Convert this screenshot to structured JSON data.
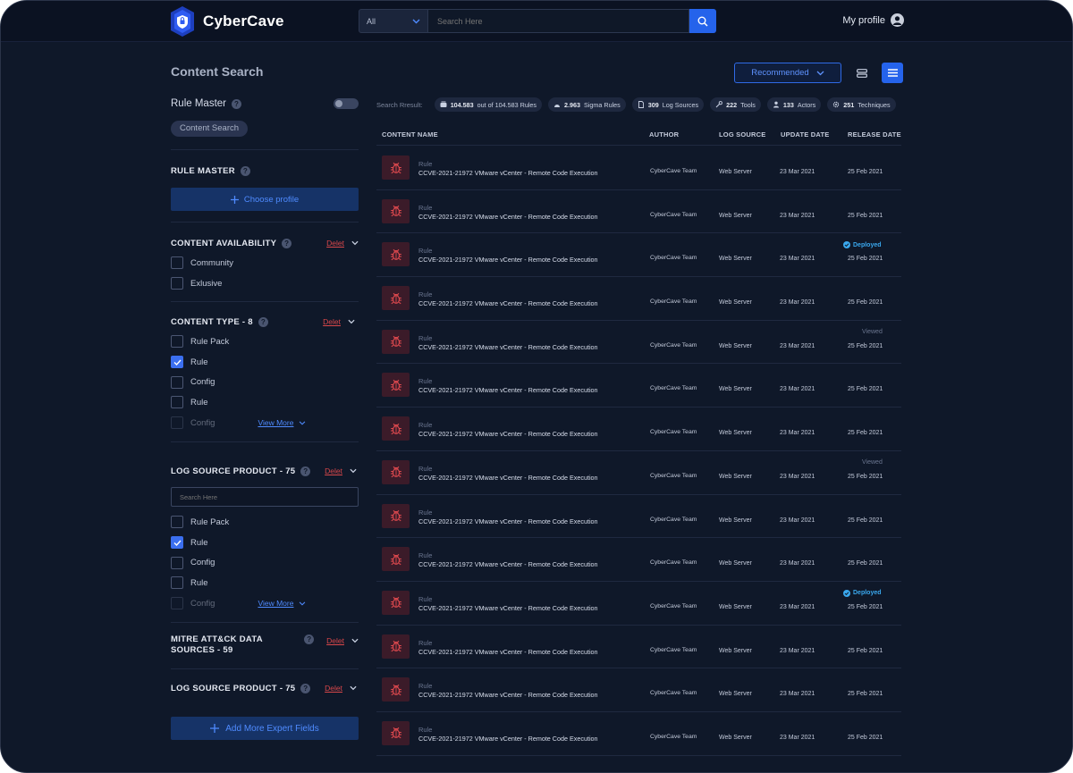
{
  "header": {
    "brand": "CyberCave",
    "search_category": "All",
    "search_placeholder": "Search Here",
    "profile_label": "My profile"
  },
  "page": {
    "title": "Content Search",
    "sort_label": "Recommended"
  },
  "sidebar": {
    "rule_master_label": "Rule Master",
    "content_search_pill": "Content Search",
    "rule_master_section": {
      "title": "RULE MASTER",
      "button": "Choose profile"
    },
    "content_availability": {
      "title": "CONTENT AVAILABILITY",
      "delete": "Delet",
      "options": [
        "Community",
        "Exlusive"
      ]
    },
    "content_type": {
      "title": "CONTENT TYPE - 8",
      "delete": "Delet",
      "options": [
        "Rule Pack",
        "Rule",
        "Config",
        "Rule",
        "Config"
      ],
      "view_more": "View More"
    },
    "log_source_product": {
      "title": "LOG SOURCE PRODUCT - 75",
      "delete": "Delet",
      "search_placeholder": "Search Here",
      "options": [
        "Rule Pack",
        "Rule",
        "Config",
        "Rule",
        "Config"
      ],
      "view_more": "View More"
    },
    "mitre": {
      "title_line1": "MITRE ATT&CK DATA",
      "title_line2": "SOURCES - 59",
      "delete": "Delet"
    },
    "log_source_product_2": {
      "title": "LOG SOURCE PRODUCT - 75",
      "delete": "Delet"
    },
    "add_more": "Add More Expert Fields"
  },
  "stats": {
    "label": "Search Rresult:",
    "rules_count": "104.583",
    "rules_text": "out of 104.583 Rules",
    "sigma_count": "2.963",
    "sigma_text": "Sigma Rules",
    "log_count": "309",
    "log_text": "Log Sources",
    "tools_count": "222",
    "tools_text": "Tools",
    "actors_count": "133",
    "actors_text": "Actors",
    "tech_count": "251",
    "tech_text": "Techniques"
  },
  "table": {
    "headers": {
      "name": "CONTENT NAME",
      "author": "AUTHOR",
      "log_source": "LOG SOURCE",
      "update": "UPDATE DATE",
      "release": "RELEASE DATE"
    },
    "rows": [
      {
        "type": "Rule",
        "title": "CCVE-2021-21972 VMware vCenter - Remote Code Execution",
        "author": "CyberCave Team",
        "log": "Web Server",
        "update": "23 Mar 2021",
        "release": "25 Feb 2021",
        "badge": ""
      },
      {
        "type": "Rule",
        "title": "CCVE-2021-21972 VMware vCenter - Remote Code Execution",
        "author": "CyberCave Team",
        "log": "Web Server",
        "update": "23 Mar 2021",
        "release": "25 Feb 2021",
        "badge": ""
      },
      {
        "type": "Rule",
        "title": "CCVE-2021-21972 VMware vCenter - Remote Code Execution",
        "author": "CyberCave Team",
        "log": "Web Server",
        "update": "23 Mar 2021",
        "release": "25 Feb 2021",
        "badge": "Deployed"
      },
      {
        "type": "Rule",
        "title": "CCVE-2021-21972 VMware vCenter - Remote Code Execution",
        "author": "CyberCave Team",
        "log": "Web Server",
        "update": "23 Mar 2021",
        "release": "25 Feb 2021",
        "badge": ""
      },
      {
        "type": "Rule",
        "title": "CCVE-2021-21972 VMware vCenter - Remote Code Execution",
        "author": "CyberCave Team",
        "log": "Web Server",
        "update": "23 Mar 2021",
        "release": "25 Feb 2021",
        "badge": "Viewed"
      },
      {
        "type": "Rule",
        "title": "CCVE-2021-21972 VMware vCenter - Remote Code Execution",
        "author": "CyberCave Team",
        "log": "Web Server",
        "update": "23 Mar 2021",
        "release": "25 Feb 2021",
        "badge": ""
      },
      {
        "type": "Rule",
        "title": "CCVE-2021-21972 VMware vCenter - Remote Code Execution",
        "author": "CyberCave Team",
        "log": "Web Server",
        "update": "23 Mar 2021",
        "release": "25 Feb 2021",
        "badge": ""
      },
      {
        "type": "Rule",
        "title": "CCVE-2021-21972 VMware vCenter - Remote Code Execution",
        "author": "CyberCave Team",
        "log": "Web Server",
        "update": "23 Mar 2021",
        "release": "25 Feb 2021",
        "badge": "Viewed"
      },
      {
        "type": "Rule",
        "title": "CCVE-2021-21972 VMware vCenter - Remote Code Execution",
        "author": "CyberCave Team",
        "log": "Web Server",
        "update": "23 Mar 2021",
        "release": "25 Feb 2021",
        "badge": ""
      },
      {
        "type": "Rule",
        "title": "CCVE-2021-21972 VMware vCenter - Remote Code Execution",
        "author": "CyberCave Team",
        "log": "Web Server",
        "update": "23 Mar 2021",
        "release": "25 Feb 2021",
        "badge": ""
      },
      {
        "type": "Rule",
        "title": "CCVE-2021-21972 VMware vCenter - Remote Code Execution",
        "author": "CyberCave Team",
        "log": "Web Server",
        "update": "23 Mar 2021",
        "release": "25 Feb 2021",
        "badge": "Deployed"
      },
      {
        "type": "Rule",
        "title": "CCVE-2021-21972 VMware vCenter - Remote Code Execution",
        "author": "CyberCave Team",
        "log": "Web Server",
        "update": "23 Mar 2021",
        "release": "25 Feb 2021",
        "badge": ""
      },
      {
        "type": "Rule",
        "title": "CCVE-2021-21972 VMware vCenter - Remote Code Execution",
        "author": "CyberCave Team",
        "log": "Web Server",
        "update": "23 Mar 2021",
        "release": "25 Feb 2021",
        "badge": ""
      },
      {
        "type": "Rule",
        "title": "CCVE-2021-21972 VMware vCenter - Remote Code Execution",
        "author": "CyberCave Team",
        "log": "Web Server",
        "update": "23 Mar 2021",
        "release": "25 Feb 2021",
        "badge": ""
      }
    ]
  },
  "colors": {
    "accent": "#2563eb",
    "background": "#0f1829",
    "danger": "#d9474a",
    "deployed": "#3aa8ee"
  },
  "icons": [
    "search-icon",
    "chevron-down-icon",
    "user-icon",
    "list-view-icon",
    "grid-view-icon",
    "bug-icon",
    "plus-icon",
    "check-icon",
    "help-icon"
  ]
}
